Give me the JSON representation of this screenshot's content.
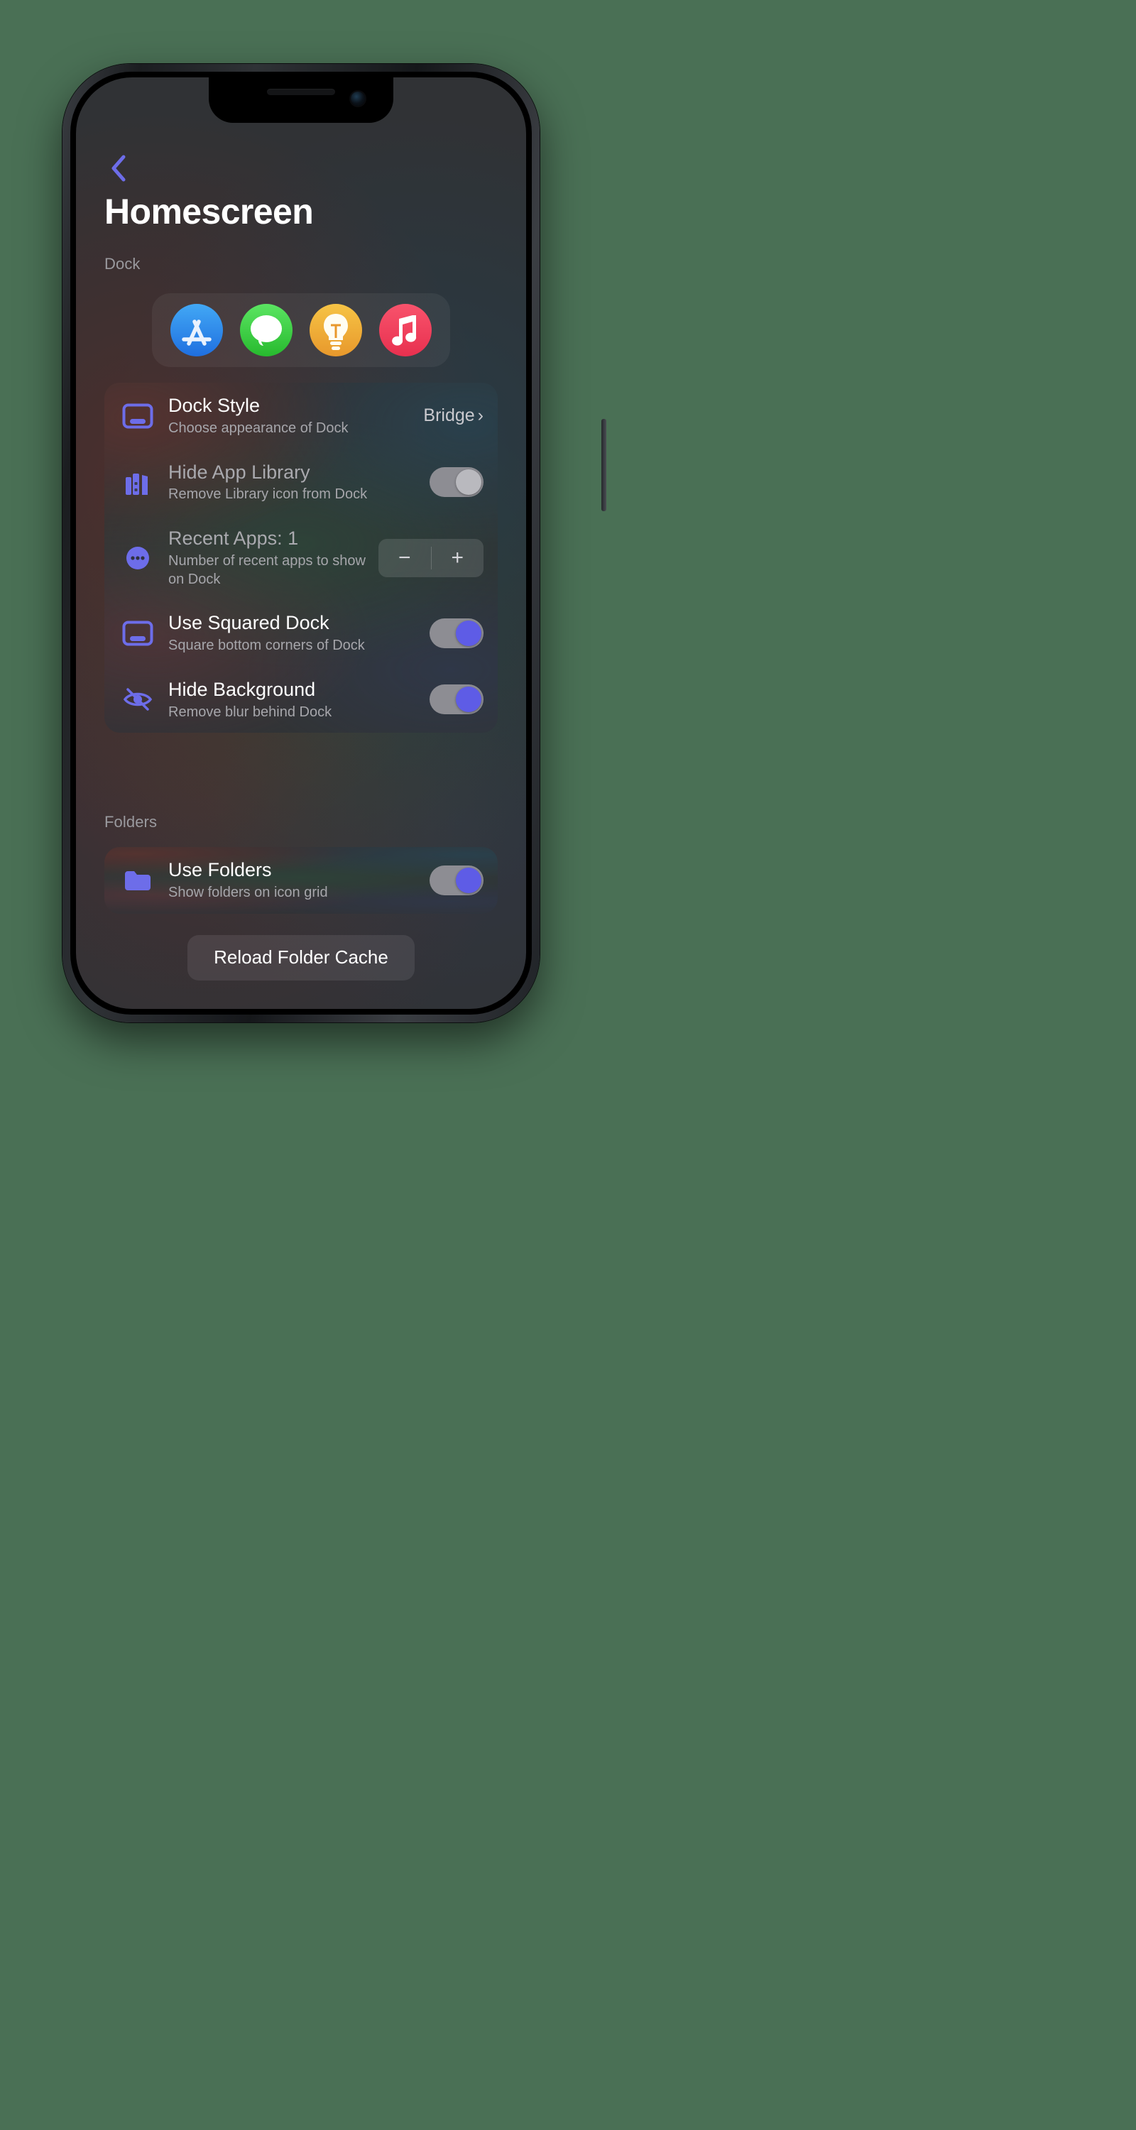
{
  "nav": {
    "back_icon": "chevron-left-icon"
  },
  "header": {
    "title": "Homescreen"
  },
  "sections": {
    "dock": {
      "label": "Dock",
      "preview_apps": [
        {
          "name": "App Store",
          "icon": "app-store-icon",
          "color": "#2f8ded"
        },
        {
          "name": "Messages",
          "icon": "messages-icon",
          "color": "#3fce45"
        },
        {
          "name": "Tips",
          "icon": "tips-lightbulb-icon",
          "color": "#f0ad37"
        },
        {
          "name": "Music",
          "icon": "music-note-icon",
          "color": "#f04258"
        }
      ],
      "rows": [
        {
          "id": "dock-style",
          "icon": "dock-rect-icon",
          "title": "Dock Style",
          "subtitle": "Choose appearance of Dock",
          "control": "disclosure",
          "value": "Bridge",
          "chevron": "›",
          "dimmed": false
        },
        {
          "id": "hide-app-library",
          "icon": "books-icon",
          "title": "Hide App Library",
          "subtitle": "Remove Library icon from Dock",
          "control": "toggle",
          "toggle_on": false,
          "dimmed": true
        },
        {
          "id": "recent-apps",
          "icon": "ellipsis-circle-icon",
          "title": "Recent Apps: 1",
          "subtitle": "Number of recent apps to show on Dock",
          "control": "stepper",
          "minus_label": "−",
          "plus_label": "+",
          "dimmed": true
        },
        {
          "id": "use-squared-dock",
          "icon": "dock-rect-icon",
          "title": "Use Squared Dock",
          "subtitle": "Square bottom corners of Dock",
          "control": "toggle",
          "toggle_on": true,
          "dimmed": false
        },
        {
          "id": "hide-background",
          "icon": "eye-slash-icon",
          "title": "Hide Background",
          "subtitle": "Remove blur behind Dock",
          "control": "toggle",
          "toggle_on": true,
          "dimmed": false
        }
      ]
    },
    "folders": {
      "label": "Folders",
      "rows": [
        {
          "id": "use-folders",
          "icon": "folder-icon",
          "title": "Use Folders",
          "subtitle": "Show folders on icon grid",
          "control": "toggle",
          "toggle_on": true,
          "dimmed": false
        }
      ]
    }
  },
  "footer": {
    "reload_button": "Reload Folder Cache"
  },
  "colors": {
    "accent_icon": "#6d6de9",
    "toggle_on": "#5e5ce6",
    "toggle_track": "#8d8d93",
    "back_chevron": "#6d6de9",
    "title_text": "#ffffff",
    "section_label": "#9a9a9f",
    "subtitle_text": "#a6a6ab"
  }
}
